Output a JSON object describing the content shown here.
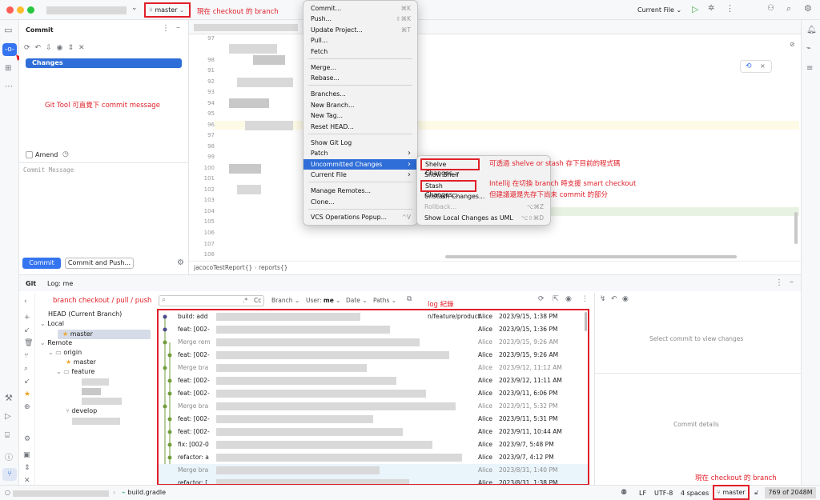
{
  "titlebar": {
    "project_menu_chevron": "⌄",
    "branch": "master",
    "branch_annotation": "現在 checkout 的 branch",
    "run_config": "Current File"
  },
  "commit_panel": {
    "title": "Commit",
    "changes_label": "Changes",
    "amend_label": "Amend",
    "message_placeholder": "Commit Message",
    "commit_button": "Commit",
    "commit_push_button": "Commit and Push...",
    "annotation": "Git Tool 可直覺下 commit message"
  },
  "editor": {
    "line_numbers": [
      "97",
      "98",
      "91",
      "92",
      "93",
      "94",
      "95",
      "96",
      "97",
      "98",
      "99",
      "100",
      "101",
      "102",
      "103",
      "104",
      "105",
      "106",
      "107",
      "108"
    ],
    "breadcrumb": [
      "jacocoTestReport{}",
      "reports{}"
    ]
  },
  "git_menu": {
    "items": [
      {
        "label": "Commit...",
        "shortcut": "⌘K"
      },
      {
        "label": "Push...",
        "shortcut": "⇧⌘K"
      },
      {
        "label": "Update Project...",
        "shortcut": "⌘T"
      },
      {
        "label": "Pull...",
        "shortcut": ""
      },
      {
        "label": "Fetch",
        "shortcut": ""
      },
      {
        "label": "Merge...",
        "shortcut": ""
      },
      {
        "label": "Rebase...",
        "shortcut": ""
      },
      {
        "label": "Branches...",
        "shortcut": ""
      },
      {
        "label": "New Branch...",
        "shortcut": ""
      },
      {
        "label": "New Tag...",
        "shortcut": ""
      },
      {
        "label": "Reset HEAD...",
        "shortcut": ""
      },
      {
        "label": "Show Git Log",
        "shortcut": ""
      },
      {
        "label": "Patch",
        "shortcut": "›"
      },
      {
        "label": "Uncommitted Changes",
        "shortcut": "›"
      },
      {
        "label": "Current File",
        "shortcut": "›"
      },
      {
        "label": "Manage Remotes...",
        "shortcut": ""
      },
      {
        "label": "Clone...",
        "shortcut": ""
      },
      {
        "label": "VCS Operations Popup...",
        "shortcut": "^V"
      }
    ]
  },
  "uncommitted_submenu": {
    "items": [
      {
        "label": "Shelve Changes...",
        "shortcut": ""
      },
      {
        "label": "Show Shelf",
        "shortcut": ""
      },
      {
        "label": "Stash Changes...",
        "shortcut": ""
      },
      {
        "label": "Unstash Changes...",
        "shortcut": ""
      },
      {
        "label": "Rollback...",
        "shortcut": "⌥⌘Z"
      },
      {
        "label": "Show Local Changes as UML",
        "shortcut": "⌥⇧⌘D"
      }
    ],
    "annotation_shelve": "可透過 shelve or stash 存下目前的程式碼",
    "annotation_smart_1": "IntelliJ 在切換 branch 時支援 smart checkout",
    "annotation_smart_2": "但建議還是先存下尚未 commit 的部分"
  },
  "git_tool": {
    "tab_git": "Git",
    "tab_log": "Log: me",
    "search_regex": ".*",
    "search_case": "Cc",
    "filters": {
      "branch": "Branch",
      "user_label": "User:",
      "user_value": "me",
      "date": "Date",
      "paths": "Paths"
    },
    "branch_annotation": "branch checkout / pull / push",
    "log_annotation": "log 紀錄",
    "tree": {
      "head": "HEAD (Current Branch)",
      "local": "Local",
      "local_master": "master",
      "remote": "Remote",
      "origin": "origin",
      "origin_master": "master",
      "feature": "feature",
      "develop": "develop"
    },
    "log_rows": [
      {
        "msg": "build: add",
        "refs": "n/feature/product",
        "author": "Alice",
        "date": "2023/9/15, 1:38 PM",
        "dim": false
      },
      {
        "msg": "feat: [002-",
        "refs": "",
        "author": "Alice",
        "date": "2023/9/15, 1:36 PM",
        "dim": false
      },
      {
        "msg": "Merge rem",
        "refs": "",
        "author": "Alice",
        "date": "2023/9/15, 9:26 AM",
        "dim": true
      },
      {
        "msg": "feat: [002-",
        "refs": "",
        "author": "Alice",
        "date": "2023/9/15, 9:26 AM",
        "dim": false
      },
      {
        "msg": "Merge bra",
        "refs": "",
        "author": "Alice",
        "date": "2023/9/12, 11:12 AM",
        "dim": true
      },
      {
        "msg": "feat: [002-",
        "refs": "",
        "author": "Alice",
        "date": "2023/9/12, 11:11 AM",
        "dim": false
      },
      {
        "msg": "feat: [002-",
        "refs": "",
        "author": "Alice",
        "date": "2023/9/11, 6:06 PM",
        "dim": false
      },
      {
        "msg": "Merge bra",
        "refs": "",
        "author": "Alice",
        "date": "2023/9/11, 5:32 PM",
        "dim": true
      },
      {
        "msg": "feat: [002-",
        "refs": "",
        "author": "Alice",
        "date": "2023/9/11, 5:31 PM",
        "dim": false
      },
      {
        "msg": "feat: [002-",
        "refs": "",
        "author": "Alice",
        "date": "2023/9/11, 10:44 AM",
        "dim": false
      },
      {
        "msg": "fix: [002-0",
        "refs": "",
        "author": "Alice",
        "date": "2023/9/7, 5:48 PM",
        "dim": false
      },
      {
        "msg": "refactor: a",
        "refs": "",
        "author": "Alice",
        "date": "2023/9/7, 4:12 PM",
        "dim": false
      },
      {
        "msg": "Merge bra",
        "refs": "",
        "author": "Alice",
        "date": "2023/8/31, 1:40 PM",
        "dim": true
      },
      {
        "msg": "refactor: [",
        "refs": "",
        "author": "Alice",
        "date": "2023/8/31, 1:38 PM",
        "dim": false
      }
    ],
    "select_commit": "Select commit to view changes",
    "commit_details": "Commit details"
  },
  "statusbar": {
    "file": "build.gradle",
    "line_sep": "LF",
    "encoding": "UTF-8",
    "indent": "4 spaces",
    "branch": "master",
    "memory": "769 of 2048M",
    "branch_annotation": "現在 checkout 的 branch"
  },
  "colors": {
    "accent": "#3574f0",
    "annotation": "#e0202a",
    "graph": "#6e9d3a",
    "selection": "#2f6ed8"
  }
}
